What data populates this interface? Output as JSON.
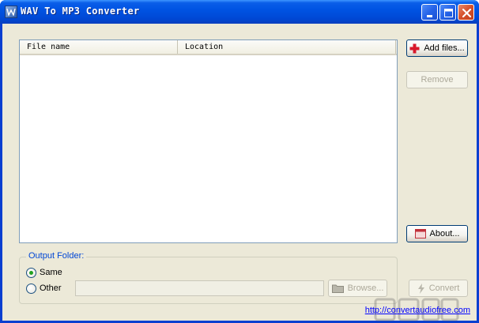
{
  "window": {
    "title": "WAV To MP3 Converter",
    "icon": "app-icon"
  },
  "titlebar_buttons": {
    "minimize": "minimize-icon",
    "maximize": "maximize-icon",
    "close": "close-icon"
  },
  "file_list": {
    "columns": [
      "File name",
      "Location"
    ],
    "rows": []
  },
  "buttons": {
    "add_files": "Add files...",
    "remove": "Remove",
    "about": "About...",
    "browse": "Browse...",
    "convert": "Convert"
  },
  "output_folder": {
    "title": "Output Folder:",
    "options": [
      {
        "label": "Same",
        "selected": true
      },
      {
        "label": "Other",
        "selected": false
      }
    ],
    "path_value": ""
  },
  "footer_link": "http://convertaudiofree.com",
  "colors": {
    "titlebar": "#0054e3",
    "client_bg": "#ece9d8",
    "group_title": "#0046d5",
    "link": "#0000ff",
    "radio_dot": "#21a121"
  }
}
